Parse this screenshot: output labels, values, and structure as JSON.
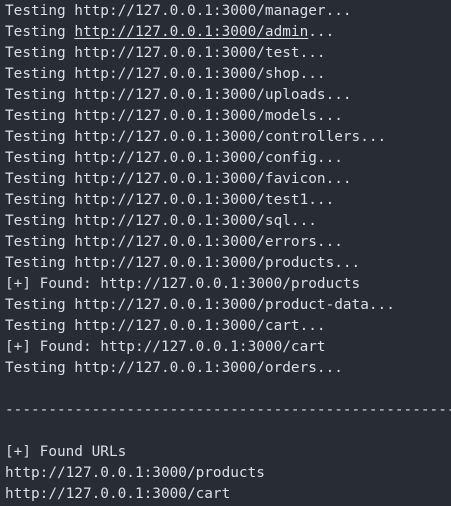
{
  "terminal": {
    "lines": [
      "Testing http://127.0.0.1:3000/manager...",
      "Testing http://127.0.0.1:3000/admin...",
      "Testing http://127.0.0.1:3000/test...",
      "Testing http://127.0.0.1:3000/shop...",
      "Testing http://127.0.0.1:3000/uploads...",
      "Testing http://127.0.0.1:3000/models...",
      "Testing http://127.0.0.1:3000/controllers...",
      "Testing http://127.0.0.1:3000/config...",
      "Testing http://127.0.0.1:3000/favicon...",
      "Testing http://127.0.0.1:3000/test1...",
      "Testing http://127.0.0.1:3000/sql...",
      "Testing http://127.0.0.1:3000/errors...",
      "Testing http://127.0.0.1:3000/products...",
      "[+] Found: http://127.0.0.1:3000/products",
      "Testing http://127.0.0.1:3000/product-data...",
      "Testing http://127.0.0.1:3000/cart...",
      "[+] Found: http://127.0.0.1:3000/cart",
      "Testing http://127.0.0.1:3000/orders..."
    ],
    "admin_prefix": "Testing ",
    "admin_link": "http://127.0.0.1:3000/admin",
    "admin_suffix": "...",
    "divider": "----------------------------------------------------",
    "found_header": "[+] Found URLs",
    "found_urls": [
      "http://127.0.0.1:3000/products",
      "http://127.0.0.1:3000/cart"
    ],
    "colors": {
      "background": "#282c33",
      "foreground": "#dcdfe4"
    }
  }
}
